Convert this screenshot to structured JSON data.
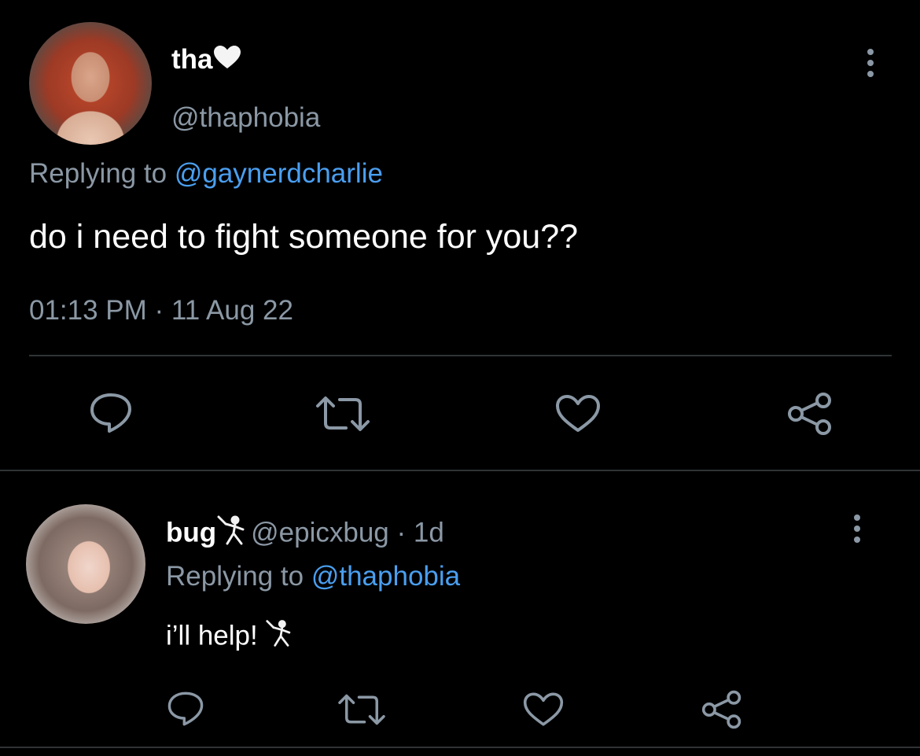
{
  "main_tweet": {
    "display_name": "tha",
    "name_emoji": "white-heart-icon",
    "handle": "@thaphobia",
    "replying_prefix": "Replying to ",
    "replying_handle": "@gaynerdcharlie",
    "text": "do i need to fight someone for you??",
    "timestamp": "01:13 PM · 11 Aug 22"
  },
  "reply_tweet": {
    "display_name": "bug",
    "name_emoji": "fencer-icon",
    "handle": "@epicxbug",
    "separator": " · ",
    "age": "1d",
    "replying_prefix": "Replying to ",
    "replying_handle": "@thaphobia",
    "text": "i’ll help!",
    "text_emoji": "fencer-icon"
  },
  "actions": [
    "reply-icon",
    "retweet-icon",
    "like-icon",
    "share-icon"
  ],
  "colors": {
    "background": "#000000",
    "secondary_text": "#8b98a5",
    "link": "#4a9ff0",
    "divider": "#2f3336",
    "icon": "#8b98a5"
  }
}
